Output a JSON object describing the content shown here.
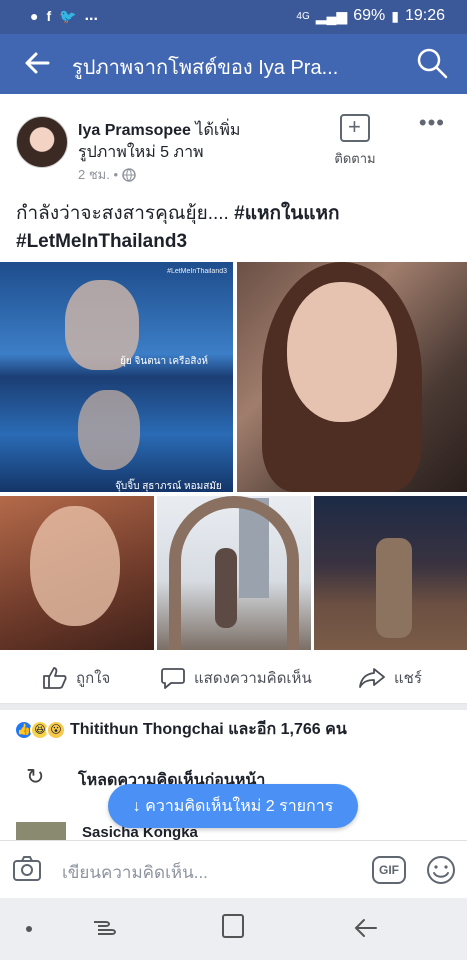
{
  "status_bar": {
    "left_icons": [
      "line-icon",
      "facebook-icon",
      "twitter-icon"
    ],
    "dots": "...",
    "network": "4G",
    "battery": "69%",
    "time": "19:26"
  },
  "app_bar": {
    "title": "รูปภาพจากโพสต์ของ Iya Pra..."
  },
  "post": {
    "author": "Iya Pramsopee",
    "verb": "ได้เพิ่ม",
    "subtitle": "รูปภาพใหม่ 5 ภาพ",
    "time": "2 ชม. •",
    "follow_label": "ติดตาม",
    "more": "•••",
    "text_plain": "กำลังว่าจะสงสารคุณยุ้ย.... ",
    "text_tag1": "#แหกในแหก",
    "text_tag2": "#LetMeInThailand3"
  },
  "photos": {
    "photo1_hashtag": "#LetMeInThailand3",
    "photo1_caption1": "ยุ้ย จินตนา เครือสิงห์",
    "photo1_caption2": "จุ๊บจิ๊บ สุธาภรณ์ หอมสมัย"
  },
  "actions": {
    "like": "ถูกใจ",
    "comment": "แสดงความคิดเห็น",
    "share": "แชร์"
  },
  "reactions": {
    "summary": "Thitithun Thongchai และอีก 1,766 คน"
  },
  "comments": {
    "load_previous": "โหลดความคิดเห็นก่อนหน้า",
    "new_comments": "↓ ความคิดเห็นใหม่ 2 รายการ",
    "partial_name": "Sasicha Kongka"
  },
  "composer": {
    "placeholder": "เขียนความคิดเห็น...",
    "gif": "GIF"
  },
  "colors": {
    "facebook_blue": "#4267b2",
    "status_blue": "#3b5998",
    "pill_blue": "#4a90f5"
  }
}
